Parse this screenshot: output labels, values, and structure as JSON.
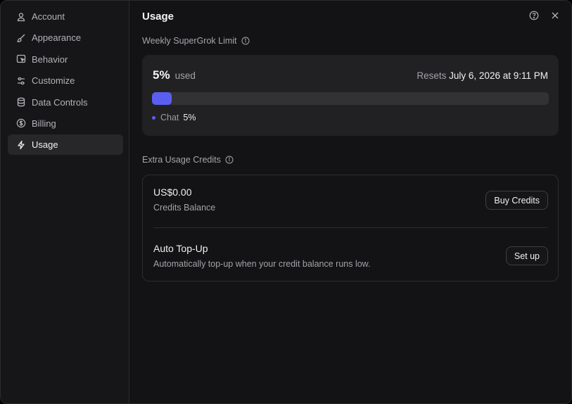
{
  "sidebar": {
    "items": [
      {
        "label": "Account",
        "icon": "person-icon"
      },
      {
        "label": "Appearance",
        "icon": "brush-icon"
      },
      {
        "label": "Behavior",
        "icon": "cursor-window-icon"
      },
      {
        "label": "Customize",
        "icon": "sliders-icon"
      },
      {
        "label": "Data Controls",
        "icon": "database-icon"
      },
      {
        "label": "Billing",
        "icon": "dollar-circle-icon"
      },
      {
        "label": "Usage",
        "icon": "lightning-icon",
        "active": true
      }
    ]
  },
  "header": {
    "title": "Usage"
  },
  "weekly": {
    "label": "Weekly SuperGrok Limit",
    "percent": "5%",
    "used_label": "used",
    "resets_prefix": "Resets",
    "resets_date": "July 6, 2026 at 9:11 PM",
    "progress_fraction": 0.05,
    "legend": {
      "name": "Chat",
      "value": "5%"
    }
  },
  "credits": {
    "label": "Extra Usage Credits",
    "balance": "US$0.00",
    "balance_label": "Credits Balance",
    "buy_label": "Buy Credits",
    "topup_title": "Auto Top-Up",
    "topup_desc": "Automatically top-up when your credit balance runs low.",
    "setup_label": "Set up"
  },
  "colors": {
    "accent": "#5b5ff0",
    "background": "#131315",
    "card": "#212123"
  }
}
